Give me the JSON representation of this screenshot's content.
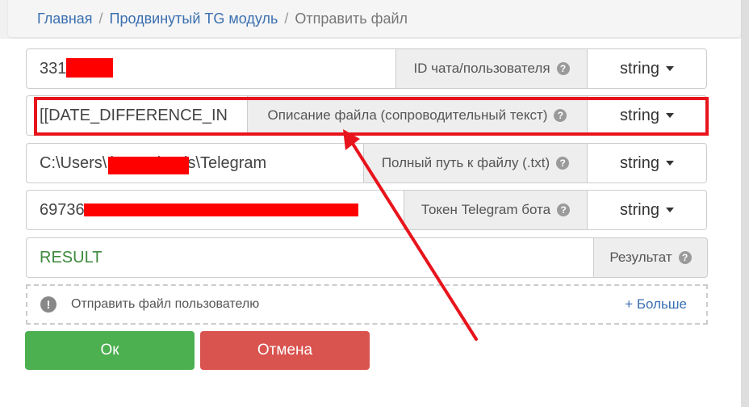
{
  "breadcrumb": {
    "home": "Главная",
    "module": "Продвинутый TG модуль",
    "current": "Отправить файл",
    "separator": "/"
  },
  "rows": [
    {
      "value": "331      0",
      "label": "ID чата/пользователя",
      "type": "string"
    },
    {
      "value": "[[DATE_DIFFERENCE_IN",
      "label": "Описание файла (сопроводительный текст)",
      "type": "string"
    },
    {
      "value": "C:\\Users\\          \\Downloads\\Telegram",
      "label": "Полный путь к файлу (.txt)",
      "type": "string"
    },
    {
      "value": "69736                                                  IEuC",
      "label": "Токен Telegram бота",
      "type": "string"
    }
  ],
  "result": {
    "value": "RESULT",
    "label": "Результат"
  },
  "more": {
    "text": "Отправить файл пользователю",
    "link": "+ Больше"
  },
  "buttons": {
    "ok": "Ок",
    "cancel": "Отмена"
  },
  "icons": {
    "help": "?",
    "info": "!"
  },
  "colors": {
    "link": "#3a6fb0",
    "ok": "#4caf50",
    "cancel": "#d9534f",
    "annotation": "#e8141c",
    "result_text": "#3c8a3c"
  }
}
